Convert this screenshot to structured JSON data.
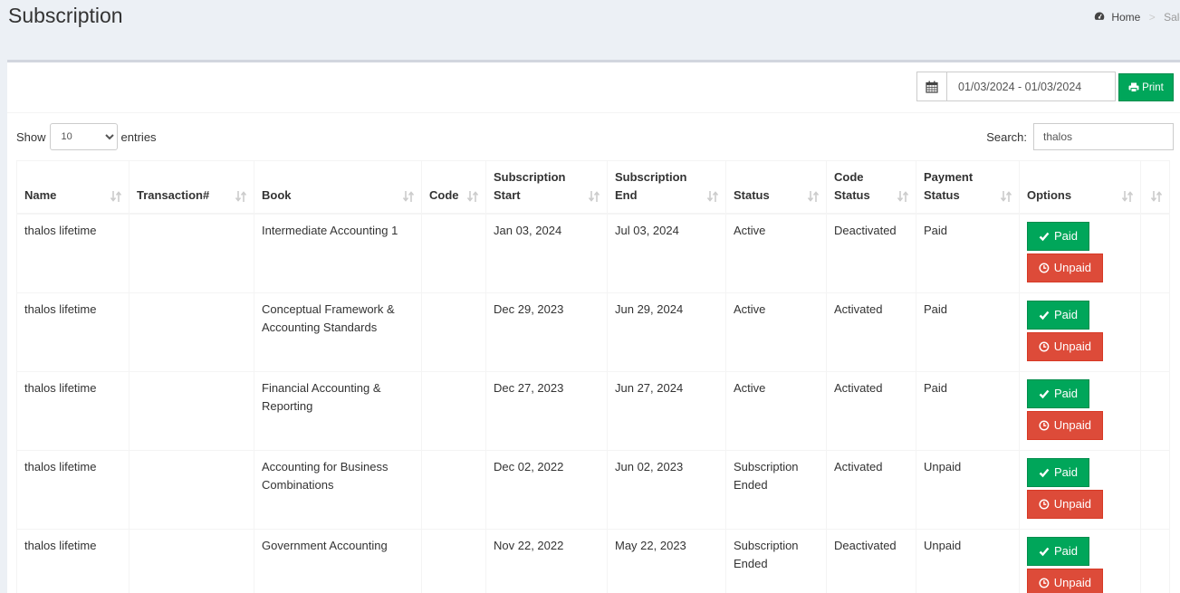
{
  "header": {
    "title": "Subscription",
    "breadcrumb": [
      "Home",
      "Sales"
    ]
  },
  "toolbar": {
    "date_range": "01/03/2024 - 01/03/2024",
    "print_label": "Print"
  },
  "table_controls": {
    "show_label": "Show",
    "entries_value": "10",
    "entries_label": "entries",
    "search_label": "Search:",
    "search_value": "thalos"
  },
  "columns": [
    "Name",
    "Transaction#",
    "Book",
    "Code",
    "Subscription Start",
    "Subscription End",
    "Status",
    "Code Status",
    "Payment Status",
    "Options",
    ""
  ],
  "rows": [
    {
      "name": "thalos lifetime",
      "transaction": "",
      "book": "Intermediate Accounting 1",
      "code": "",
      "start": "Jan 03, 2024",
      "end": "Jul 03, 2024",
      "status": "Active",
      "code_status": "Deactivated",
      "payment": "Paid"
    },
    {
      "name": "thalos lifetime",
      "transaction": "",
      "book": "Conceptual Framework & Accounting Standards",
      "code": "",
      "start": "Dec 29, 2023",
      "end": "Jun 29, 2024",
      "status": "Active",
      "code_status": "Activated",
      "payment": "Paid"
    },
    {
      "name": "thalos lifetime",
      "transaction": "",
      "book": "Financial Accounting & Reporting",
      "code": "",
      "start": "Dec 27, 2023",
      "end": "Jun 27, 2024",
      "status": "Active",
      "code_status": "Activated",
      "payment": "Paid"
    },
    {
      "name": "thalos lifetime",
      "transaction": "",
      "book": "Accounting for Business Combinations",
      "code": "",
      "start": "Dec 02, 2022",
      "end": "Jun 02, 2023",
      "status": "Subscription Ended",
      "code_status": "Activated",
      "payment": "Unpaid"
    },
    {
      "name": "thalos lifetime",
      "transaction": "",
      "book": "Government Accounting",
      "code": "",
      "start": "Nov 22, 2022",
      "end": "May 22, 2023",
      "status": "Subscription Ended",
      "code_status": "Deactivated",
      "payment": "Unpaid"
    }
  ],
  "row_actions": {
    "paid_label": "Paid",
    "unpaid_label": "Unpaid"
  },
  "colors": {
    "success": "#00a65a",
    "danger": "#dd4b39",
    "background": "#ecf0f5"
  },
  "icons": {
    "breadcrumb": "dashboard-icon",
    "date": "calendar-icon",
    "print": "print-icon",
    "sort": "sort-icon",
    "paid": "check-icon",
    "unpaid": "clock-icon"
  }
}
